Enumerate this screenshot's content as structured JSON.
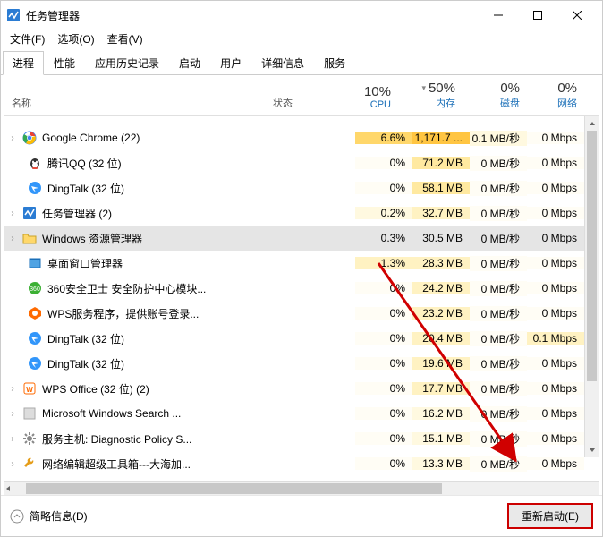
{
  "title": "任务管理器",
  "menu": {
    "file": "文件(F)",
    "options": "选项(O)",
    "view": "查看(V)"
  },
  "tabs": [
    "进程",
    "性能",
    "应用历史记录",
    "启动",
    "用户",
    "详细信息",
    "服务"
  ],
  "activeTab": 0,
  "columns": {
    "name": "名称",
    "status": "状态",
    "cpu": {
      "pct": "10%",
      "label": "CPU"
    },
    "mem": {
      "pct": "50%",
      "label": "内存"
    },
    "disk": {
      "pct": "0%",
      "label": "磁盘"
    },
    "net": {
      "pct": "0%",
      "label": "网络"
    }
  },
  "processes": [
    {
      "icon": "chrome",
      "name": "Google Chrome (22)",
      "expandable": true,
      "cpu": "6.6%",
      "cpuHeat": 4,
      "mem": "1,171.7 ...",
      "memHeat": 5,
      "disk": "0.1 MB/秒",
      "diskHeat": 1,
      "net": "0 Mbps",
      "netHeat": 0
    },
    {
      "icon": "qq",
      "name": "腾讯QQ (32 位)",
      "expandable": false,
      "indent": true,
      "cpu": "0%",
      "cpuHeat": 0,
      "mem": "71.2 MB",
      "memHeat": 3,
      "disk": "0 MB/秒",
      "diskHeat": 0,
      "net": "0 Mbps",
      "netHeat": 0
    },
    {
      "icon": "dingtalk",
      "name": "DingTalk (32 位)",
      "expandable": false,
      "indent": true,
      "cpu": "0%",
      "cpuHeat": 0,
      "mem": "58.1 MB",
      "memHeat": 3,
      "disk": "0 MB/秒",
      "diskHeat": 0,
      "net": "0 Mbps",
      "netHeat": 0
    },
    {
      "icon": "taskmgr",
      "name": "任务管理器 (2)",
      "expandable": true,
      "cpu": "0.2%",
      "cpuHeat": 1,
      "mem": "32.7 MB",
      "memHeat": 2,
      "disk": "0 MB/秒",
      "diskHeat": 0,
      "net": "0 Mbps",
      "netHeat": 0
    },
    {
      "icon": "explorer",
      "name": "Windows 资源管理器",
      "expandable": true,
      "selected": true,
      "indent": false,
      "cpu": "0.3%",
      "cpuHeat": 0,
      "mem": "30.5 MB",
      "memHeat": 0,
      "disk": "0 MB/秒",
      "diskHeat": 0,
      "net": "0 Mbps",
      "netHeat": 0
    },
    {
      "icon": "window",
      "name": "桌面窗口管理器",
      "expandable": false,
      "indent": true,
      "cpu": "1.3%",
      "cpuHeat": 2,
      "mem": "28.3 MB",
      "memHeat": 2,
      "disk": "0 MB/秒",
      "diskHeat": 0,
      "net": "0 Mbps",
      "netHeat": 0
    },
    {
      "icon": "360",
      "name": "360安全卫士 安全防护中心模块...",
      "expandable": false,
      "indent": true,
      "cpu": "0%",
      "cpuHeat": 0,
      "mem": "24.2 MB",
      "memHeat": 2,
      "disk": "0 MB/秒",
      "diskHeat": 0,
      "net": "0 Mbps",
      "netHeat": 0
    },
    {
      "icon": "wps-svc",
      "name": "WPS服务程序，提供账号登录...",
      "expandable": false,
      "indent": true,
      "cpu": "0%",
      "cpuHeat": 0,
      "mem": "23.2 MB",
      "memHeat": 2,
      "disk": "0 MB/秒",
      "diskHeat": 0,
      "net": "0 Mbps",
      "netHeat": 0
    },
    {
      "icon": "dingtalk",
      "name": "DingTalk (32 位)",
      "expandable": false,
      "indent": true,
      "cpu": "0%",
      "cpuHeat": 0,
      "mem": "20.4 MB",
      "memHeat": 2,
      "disk": "0 MB/秒",
      "diskHeat": 0,
      "net": "0.1 Mbps",
      "netHeat": 2
    },
    {
      "icon": "dingtalk",
      "name": "DingTalk (32 位)",
      "expandable": false,
      "indent": true,
      "cpu": "0%",
      "cpuHeat": 0,
      "mem": "19.6 MB",
      "memHeat": 2,
      "disk": "0 MB/秒",
      "diskHeat": 0,
      "net": "0 Mbps",
      "netHeat": 0
    },
    {
      "icon": "wps",
      "name": "WPS Office (32 位) (2)",
      "expandable": true,
      "cpu": "0%",
      "cpuHeat": 0,
      "mem": "17.7 MB",
      "memHeat": 2,
      "disk": "0 MB/秒",
      "diskHeat": 0,
      "net": "0 Mbps",
      "netHeat": 0
    },
    {
      "icon": "generic",
      "name": "Microsoft Windows Search ...",
      "expandable": true,
      "cpu": "0%",
      "cpuHeat": 0,
      "mem": "16.2 MB",
      "memHeat": 1,
      "disk": "0 MB/秒",
      "diskHeat": 0,
      "net": "0 Mbps",
      "netHeat": 0
    },
    {
      "icon": "gear",
      "name": "服务主机: Diagnostic Policy S...",
      "expandable": true,
      "cpu": "0%",
      "cpuHeat": 0,
      "mem": "15.1 MB",
      "memHeat": 1,
      "disk": "0 MB/秒",
      "diskHeat": 0,
      "net": "0 Mbps",
      "netHeat": 0
    },
    {
      "icon": "tool",
      "name": "网络编辑超级工具箱---大海加...",
      "expandable": true,
      "cpu": "0%",
      "cpuHeat": 0,
      "mem": "13.3 MB",
      "memHeat": 1,
      "disk": "0 MB/秒",
      "diskHeat": 0,
      "net": "0 Mbps",
      "netHeat": 0
    }
  ],
  "footer": {
    "less": "简略信息(D)",
    "action": "重新启动(E)"
  }
}
